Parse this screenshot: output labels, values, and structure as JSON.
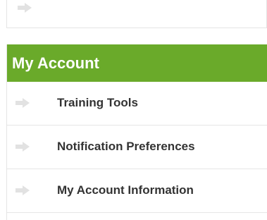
{
  "top_item": {
    "label": "",
    "icon": "arrow-right-icon"
  },
  "account_panel": {
    "title": "My Account",
    "header_color": "#6aaa2a",
    "items": [
      {
        "label": "Training Tools",
        "icon": "arrow-right-icon"
      },
      {
        "label": "Notification Preferences",
        "icon": "arrow-right-icon"
      },
      {
        "label": "My Account Information",
        "icon": "arrow-right-icon"
      }
    ]
  }
}
